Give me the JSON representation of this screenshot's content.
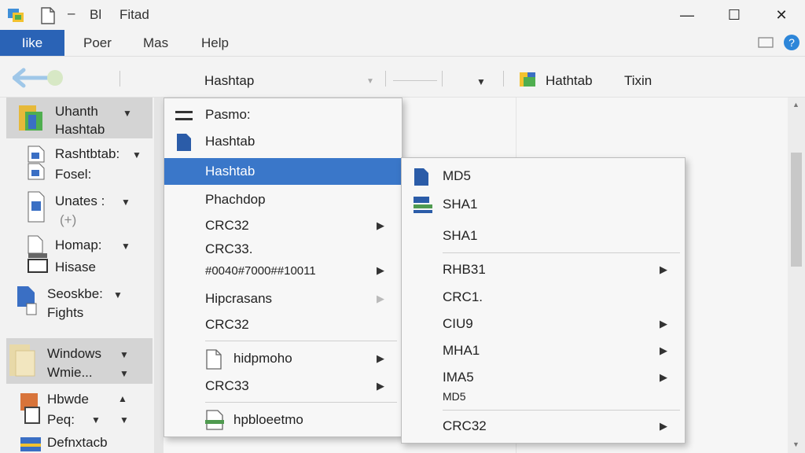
{
  "window": {
    "title": "Fitad",
    "qat_text": "Bl",
    "minimize": "—",
    "maximize": "☐",
    "close": "✕"
  },
  "ribbon": {
    "tabs": [
      "Iike",
      "Poer",
      "Mas",
      "Help"
    ]
  },
  "address": {
    "path": "Hashtap",
    "folder_label": "Hathtab",
    "extra": "Tixin"
  },
  "nav": {
    "items": [
      {
        "line1": "Uhanth",
        "line2": "Hashtab"
      },
      {
        "line1": "Rashtbtab:",
        "line2": "Fosel:"
      },
      {
        "line1": "Unates :",
        "line2": "(+)"
      },
      {
        "line1": "Homap:",
        "line2": "Hisase"
      },
      {
        "line1": "Seoskbe:",
        "line2": "Fights"
      },
      {
        "line1": "Windows",
        "line2": "Wmie..."
      },
      {
        "line1": "Hbwde",
        "line2": "Peq:"
      },
      {
        "line1": "Defnxtacb",
        "line2": ""
      }
    ]
  },
  "context_menu": {
    "items": [
      "Pasmo:",
      "Hashtab",
      "Hashtab",
      "Phachdop",
      "CRC32",
      "CRC33.",
      "#0040#7000##10011",
      "Hipcrasans",
      "CRC32",
      "hidpmoho",
      "CRC33",
      "hpbloeetmo"
    ]
  },
  "submenu": {
    "items": [
      "MD5",
      "SHA1",
      "SHA1",
      "RHB31",
      "CRC1.",
      "CIU9",
      "MHA1",
      "IMA5",
      "MD5",
      "CRC32"
    ]
  },
  "colors": {
    "accent": "#2a63b6",
    "highlight": "#3a77c9"
  }
}
